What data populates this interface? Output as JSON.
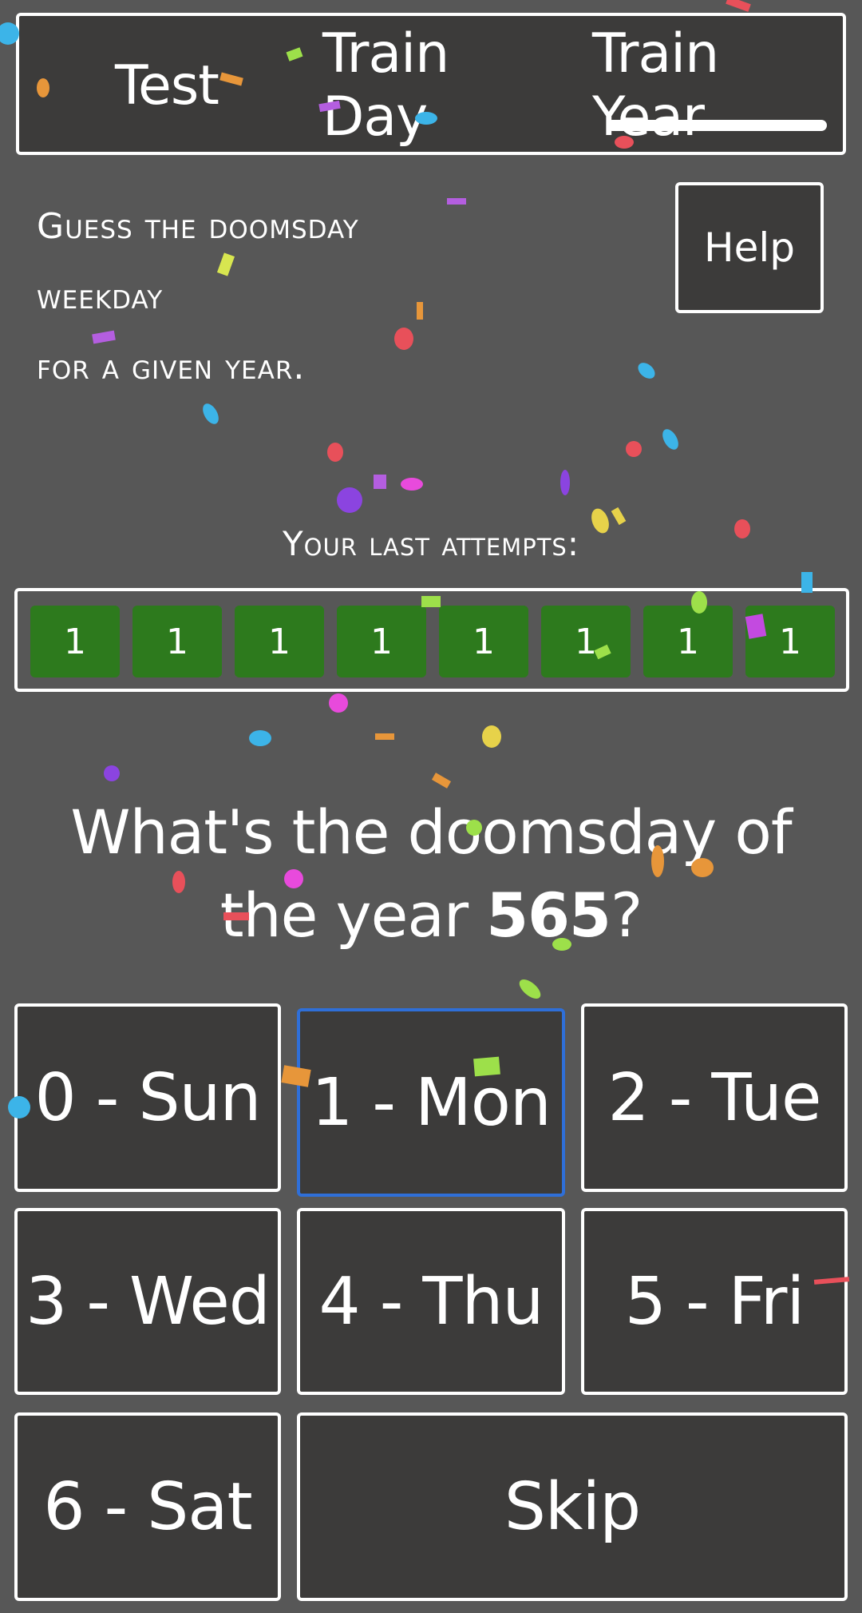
{
  "tabs": {
    "test": "Test",
    "train_day": "Train Day",
    "train_year": "Train Year",
    "active": "train_year"
  },
  "description": {
    "line1": "Guess the doomsday",
    "line2": "weekday",
    "line3": "for a given year."
  },
  "help_label": "Help",
  "last_attempts": {
    "label": "Your last attempts:",
    "values": [
      "1",
      "1",
      "1",
      "1",
      "1",
      "1",
      "1",
      "1"
    ],
    "color": "#2d7a1d"
  },
  "question": {
    "prefix": "What's the doomsday of the year ",
    "year": "565",
    "suffix": "?"
  },
  "answers": {
    "sun": "0 - Sun",
    "mon": "1 - Mon",
    "tue": "2 - Tue",
    "wed": "3 - Wed",
    "thu": "4 - Thu",
    "fri": "5 - Fri",
    "sat": "6 - Sat",
    "skip": "Skip",
    "selected": "mon"
  },
  "colors": {
    "background": "#575757",
    "panel": "#3c3b3a",
    "border": "#ffffff",
    "selected_border": "#2f6fd8"
  }
}
